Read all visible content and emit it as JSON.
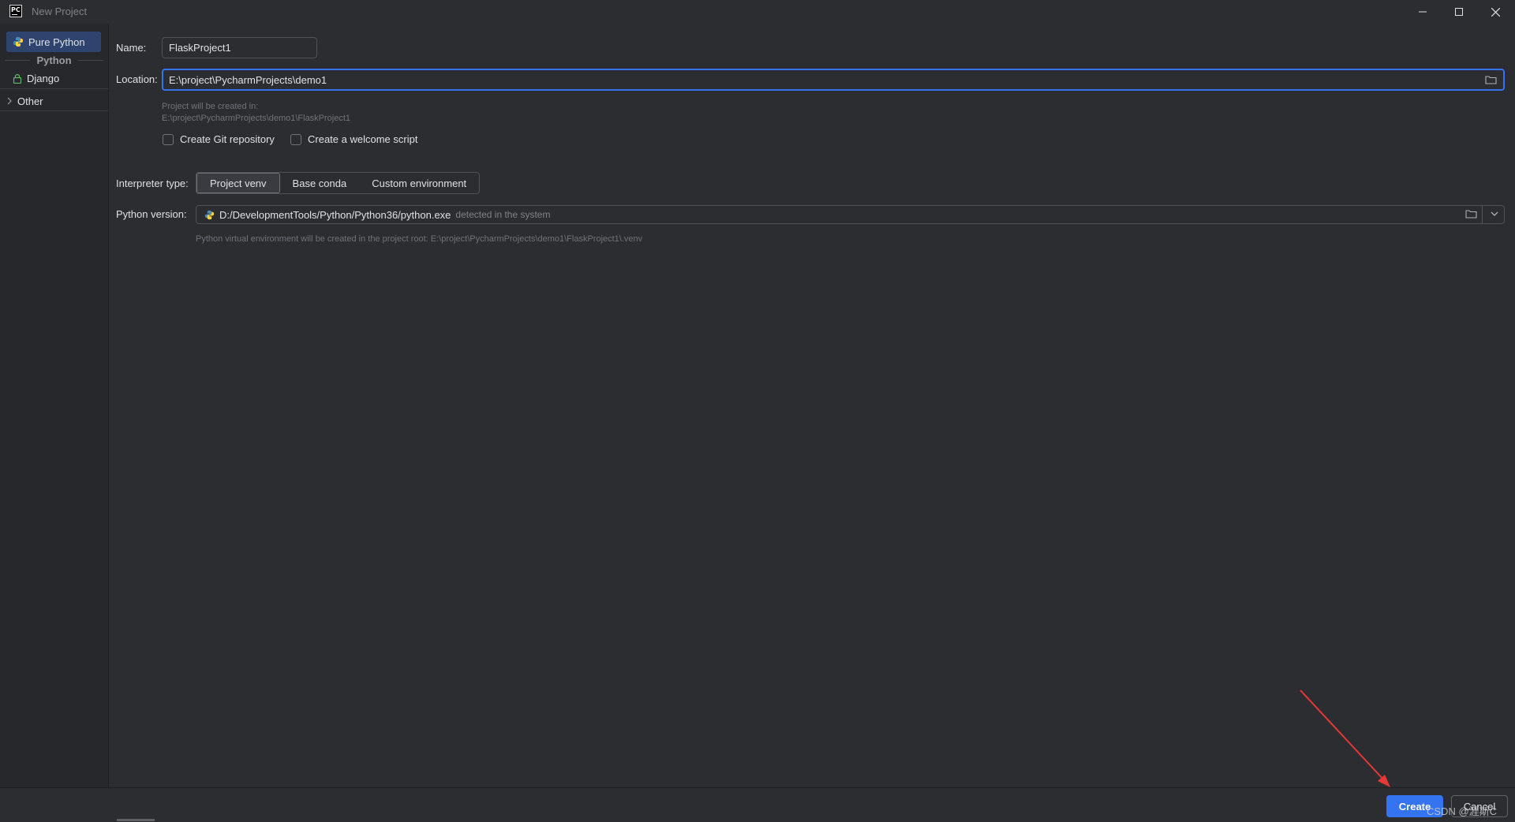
{
  "window": {
    "title": "New Project",
    "app_icon_text": "PC"
  },
  "sidebar": {
    "items": [
      {
        "label": "Pure Python",
        "icon": "python-icon",
        "selected": true
      },
      {
        "label": "Django",
        "icon": "lock-icon",
        "selected": false
      },
      {
        "label": "Other",
        "icon": "chevron-right-icon",
        "selected": false
      }
    ],
    "group_label": "Python"
  },
  "form": {
    "name_label": "Name:",
    "name_value": "FlaskProject1",
    "location_label": "Location:",
    "location_value": "E:\\project\\PycharmProjects\\demo1",
    "created_in_line1": "Project will be created in:",
    "created_in_line2": "E:\\project\\PycharmProjects\\demo1\\FlaskProject1",
    "git_checkbox_label": "Create Git repository",
    "welcome_checkbox_label": "Create a welcome script",
    "interpreter_type_label": "Interpreter type:",
    "interpreter_types": [
      "Project venv",
      "Base conda",
      "Custom environment"
    ],
    "python_version_label": "Python version:",
    "python_version_path": "D:/DevelopmentTools/Python/Python36/python.exe",
    "python_version_detected": "detected in the system",
    "venv_hint": "Python virtual environment will be created in the project root: E:\\project\\PycharmProjects\\demo1\\FlaskProject1\\.venv"
  },
  "footer": {
    "create_label": "Create",
    "cancel_label": "Cancel"
  },
  "watermark": "CSDN @涯斯C",
  "colors": {
    "accent": "#3574f0",
    "background": "#2b2d30",
    "annotation_arrow": "#e53935"
  }
}
